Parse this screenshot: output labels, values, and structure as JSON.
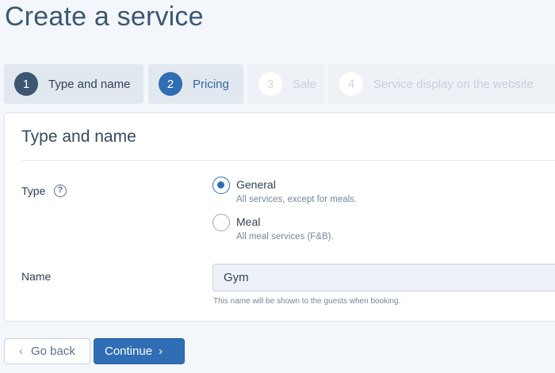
{
  "page": {
    "title": "Create a service"
  },
  "steps": [
    {
      "number": "1",
      "label": "Type and name",
      "state": "completed"
    },
    {
      "number": "2",
      "label": "Pricing",
      "state": "current"
    },
    {
      "number": "3",
      "label": "Sale",
      "state": "disabled"
    },
    {
      "number": "4",
      "label": "Service display on the website",
      "state": "disabled"
    }
  ],
  "card": {
    "title": "Type and name",
    "type_field": {
      "label": "Type",
      "help_icon": "question-circle-icon",
      "options": [
        {
          "label": "General",
          "description": "All services, except for meals.",
          "checked": true
        },
        {
          "label": "Meal",
          "description": "All meal services (F&B).",
          "checked": false
        }
      ]
    },
    "name_field": {
      "label": "Name",
      "value": "Gym",
      "hint": "This name will be shown to the guests when booking."
    }
  },
  "actions": {
    "back_label": "Go back",
    "back_icon": "chevron-left-icon",
    "continue_label": "Continue",
    "continue_icon": "chevron-right-icon"
  },
  "colors": {
    "accent": "#2f6db5",
    "title": "#3b5773",
    "background": "#f3f7fb"
  }
}
